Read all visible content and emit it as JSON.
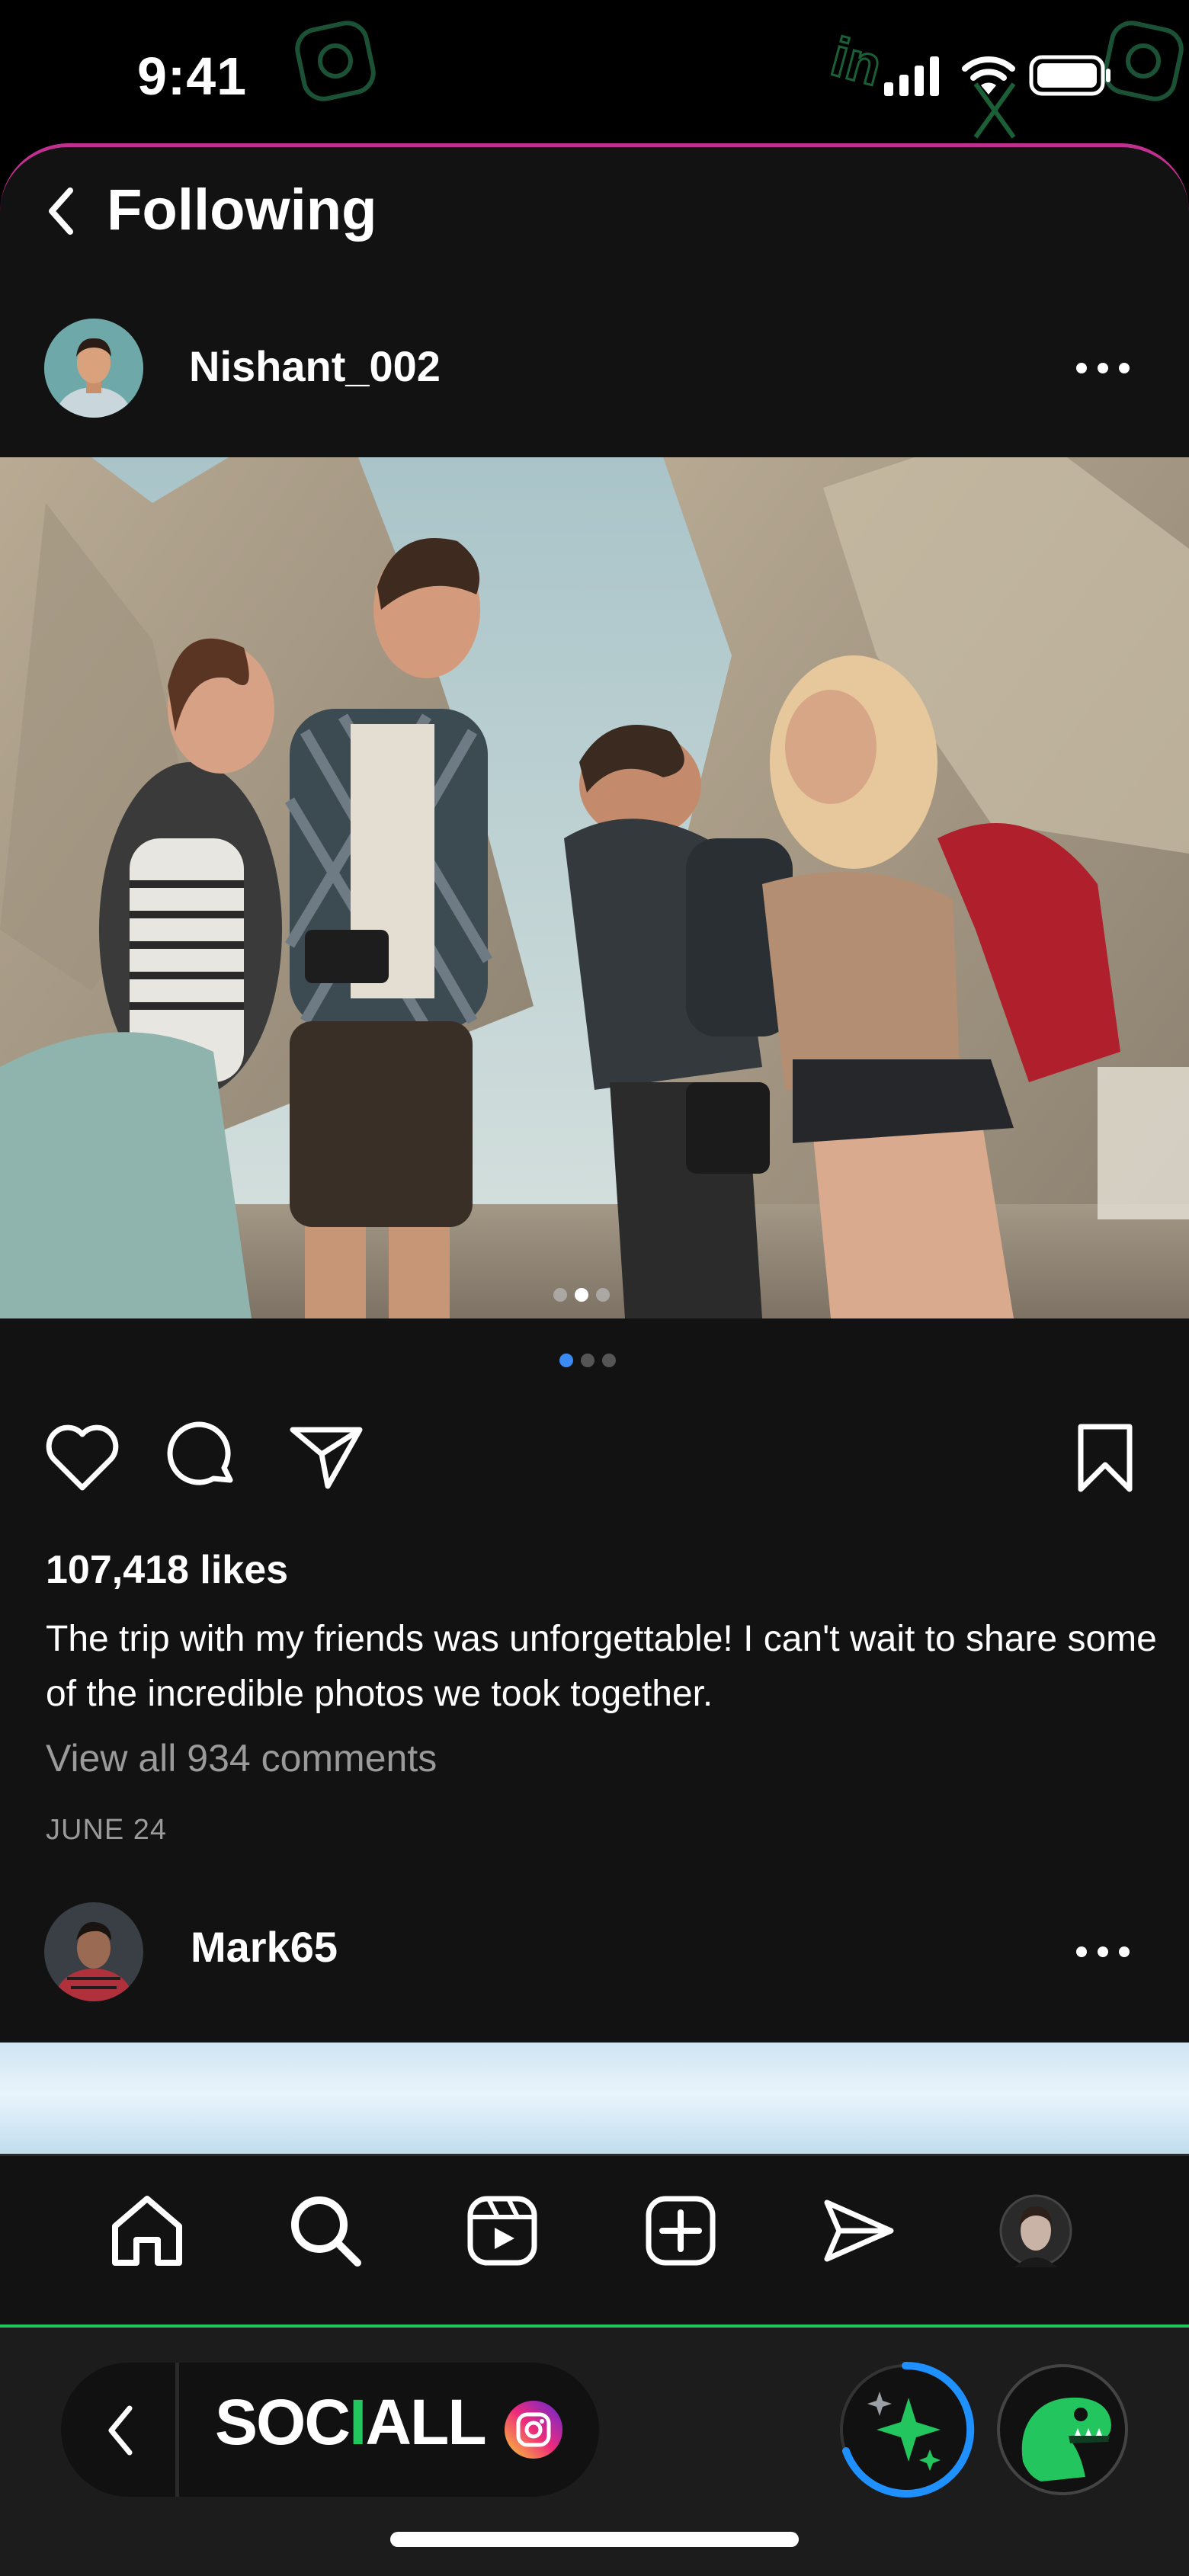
{
  "status_bar": {
    "time": "9:41"
  },
  "header": {
    "title": "Following"
  },
  "posts": [
    {
      "username": "Nishant_002",
      "likes": "107,418 likes",
      "caption": "The trip with my friends was unforgettable! I can't wait to share some of the incredible photos we took together.",
      "comments_link": "View all 934 comments",
      "date": "JUNE 24",
      "carousel": {
        "count": 3,
        "active_index": 1
      }
    },
    {
      "username": "Mark65"
    }
  ],
  "tab_bar": {
    "items": [
      "home-icon",
      "search-icon",
      "reels-icon",
      "create-icon",
      "direct-icon",
      "profile-avatar"
    ]
  },
  "launcher": {
    "brand": "SOCIALL",
    "accent": "#22c55e"
  },
  "colors": {
    "background": "#121212",
    "header_border": "#c0308f",
    "dot_active": "#3b8bf5",
    "muted_text": "#9a9a9a"
  }
}
